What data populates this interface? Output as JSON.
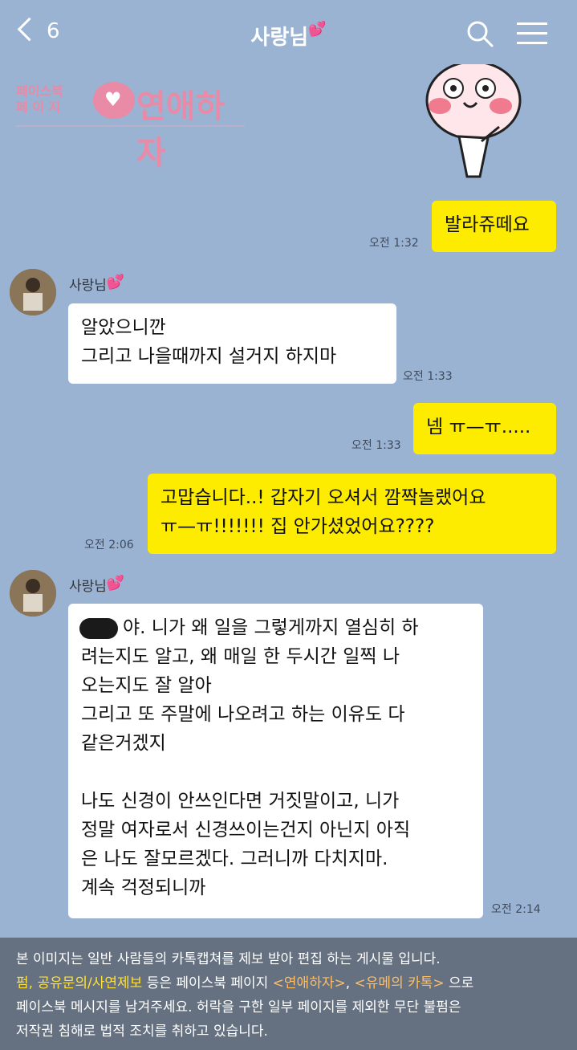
{
  "header": {
    "back_count": "6",
    "title": "사랑님",
    "title_heart": "💕"
  },
  "watermark": {
    "small_line1": "페이스북",
    "small_line2": "페 이 지",
    "brand": "연애하자"
  },
  "messages": [
    {
      "text": "발라쥬떼요",
      "time": "오전 1:32"
    },
    {
      "sender": "사랑님",
      "heart": "💕",
      "text": "알았으니깐\n그리고 나을때까지 설거지 하지마",
      "time": "오전 1:33"
    },
    {
      "text": "넴 ㅠ—ㅠ.....",
      "time": "오전 1:33"
    },
    {
      "text": "고맙습니다..! 갑자기 오셔서 깜짝놀랬어요\nㅠ—ㅠ!!!!!!! 집 안가셨었어요????",
      "time": "오전 2:06"
    },
    {
      "sender": "사랑님",
      "heart": "💕",
      "text": "야. 니가 왜 일을 그렇게까지 열심히 하\n려는지도 알고, 왜 매일 한 두시간 일찍 나\n오는지도 잘 알아\n그리고 또 주말에 나오려고 하는 이유도 다\n같은거겠지\n\n나도 신경이 안쓰인다면 거짓말이고, 니가\n정말 여자로서 신경쓰이는건지 아닌지 아직\n은 나도 잘모르겠다. 그러니까 다치지마.\n계속 걱정되니까",
      "time": "오전 2:14"
    }
  ],
  "footer": {
    "line1": "본 이미지는 일반 사람들의 카톡캡쳐를 제보 받아 편집 하는 게시물 입니다.",
    "line2_highlight": "펌, 공유문의/사연제보",
    "line2_mid": " 등은 페이스북 페이지 ",
    "line2_page1": "<연애하자>",
    "line2_sep": ", ",
    "line2_page2": "<유메의 카톡>",
    "line2_end": " 으로",
    "line3": "페이스북 메시지를 남겨주세요. 허락을 구한 일부 페이지를 제외한 무단 불펌은",
    "line4": "저작권 침해로 법적 조치를 취하고 있습니다."
  }
}
